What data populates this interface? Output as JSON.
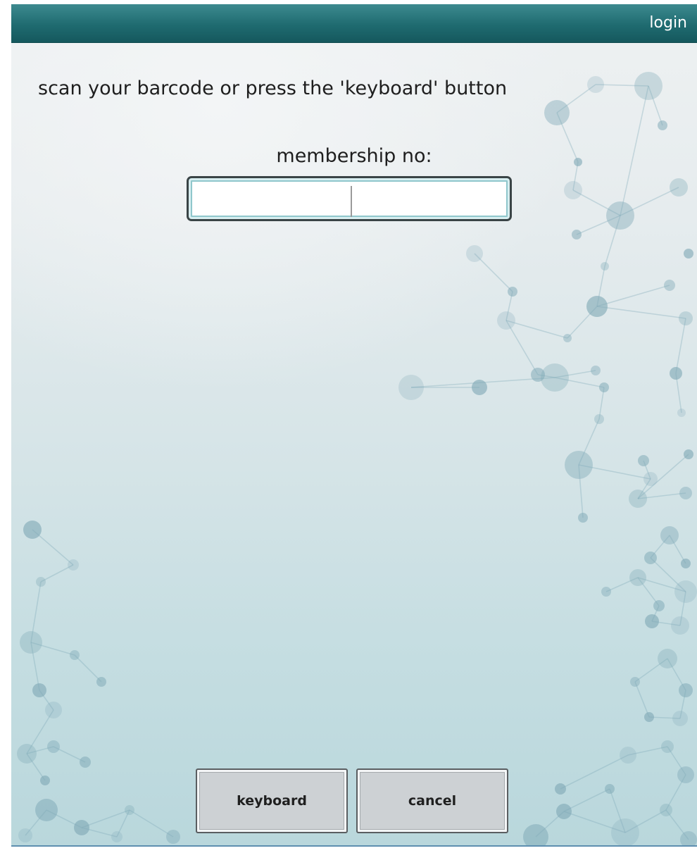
{
  "header": {
    "title": "login"
  },
  "instruction_text": "scan your barcode or press the 'keyboard' button",
  "membership": {
    "label": "membership no:",
    "value": "",
    "placeholder": ""
  },
  "buttons": {
    "keyboard_label": "keyboard",
    "cancel_label": "cancel"
  },
  "colors": {
    "header_teal": "#1f6b70",
    "background_light": "#eef1f2",
    "background_teal": "#b9d7dc",
    "button_face": "#cdd1d4",
    "molecule_node": "#7fa9b6"
  },
  "decorations": {
    "background": "molecule-network-pattern"
  }
}
